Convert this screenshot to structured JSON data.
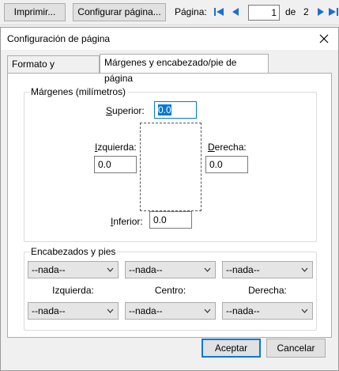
{
  "toolbar": {
    "print_label": "Imprimir...",
    "page_setup_label": "Configurar página...",
    "page_label": "Página:",
    "page_value": "1",
    "of_label": "de",
    "total_pages": "2"
  },
  "dialog": {
    "title": "Configuración de página",
    "tabs": [
      {
        "label": "Formato y opciones",
        "active": false
      },
      {
        "label": "Márgenes y encabezado/pie de página",
        "active": true
      }
    ],
    "margins": {
      "legend": "Márgenes (milímetros)",
      "top_label_accel": "S",
      "top_label_rest": "uperior:",
      "top_value": "0.0",
      "left_label_accel": "I",
      "left_label_rest": "zquierda:",
      "left_value": "0.0",
      "right_label_accel": "D",
      "right_label_rest": "erecha:",
      "right_value": "0.0",
      "bottom_label_accel": "I",
      "bottom_label_rest": "nferior:",
      "bottom_value": "0.0"
    },
    "headers_footers": {
      "legend": "Encabezados y pies",
      "header_left": "--nada--",
      "header_center": "--nada--",
      "header_right": "--nada--",
      "left_label": "Izquierda:",
      "center_label": "Centro:",
      "right_label": "Derecha:",
      "footer_left": "--nada--",
      "footer_center": "--nada--",
      "footer_right": "--nada--"
    },
    "accept_label": "Aceptar",
    "cancel_label": "Cancelar"
  },
  "colors": {
    "accent": "#0078d7",
    "nav_arrow": "#1a6fd1"
  },
  "icons": [
    "first-page-icon",
    "previous-page-icon",
    "next-page-icon",
    "last-page-icon",
    "close-icon",
    "chevron-down-icon"
  ]
}
